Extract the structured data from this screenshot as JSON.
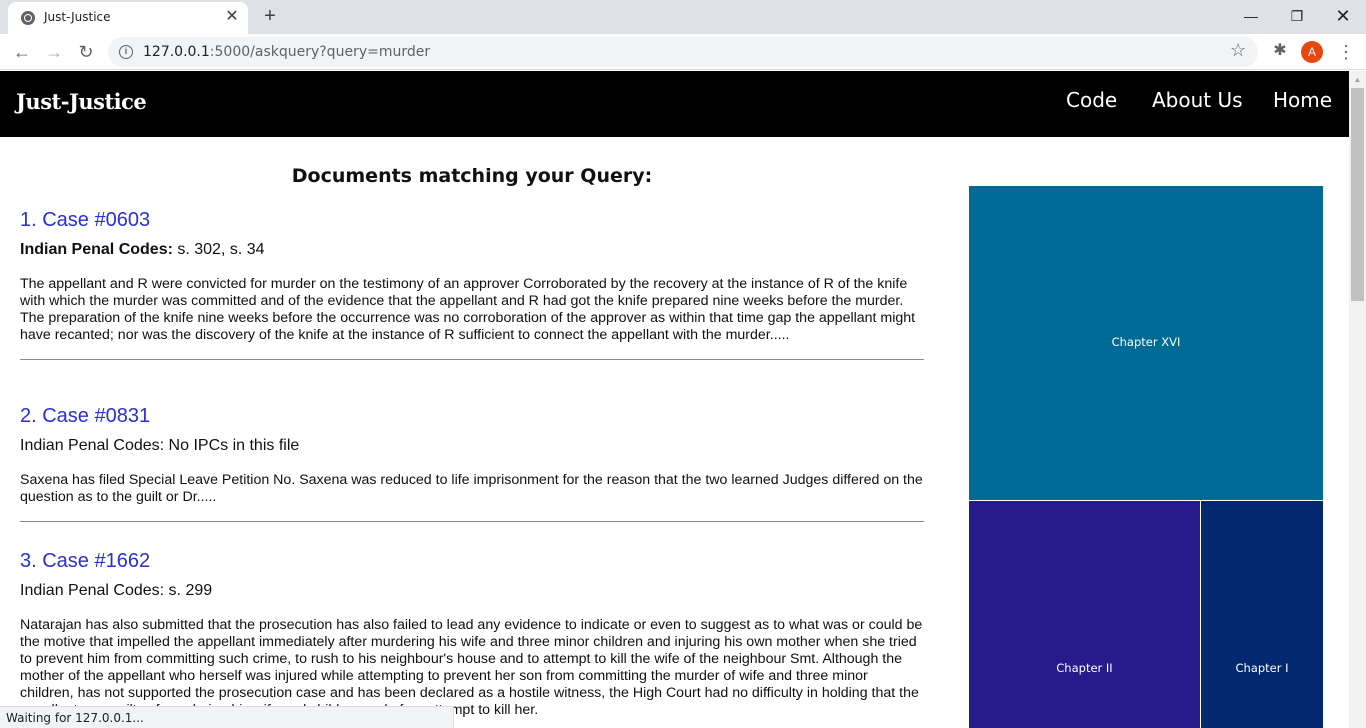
{
  "browser": {
    "tab_title": "Just-Justice",
    "url_host": "127.0.0.1",
    "url_rest": ":5000/askquery?query=murder",
    "avatar_letter": "A",
    "status_text": "Waiting for 127.0.0.1..."
  },
  "site": {
    "brand": "Just-Justice",
    "nav": [
      "Code",
      "About Us",
      "Home"
    ]
  },
  "results": {
    "heading": "Documents matching your Query:",
    "items": [
      {
        "title": "1. Case #0603",
        "ipc_label": "Indian Penal Codes:",
        "ipc_value": " s. 302, s. 34",
        "ipc_bold": true,
        "body": "The appellant and R were convicted for murder on the testimony of an approver Corroborated by the recovery at the instance of R of the knife with which the murder was committed and of the evidence that the appellant and R had got the knife prepared nine weeks before the murder. The preparation of the knife nine weeks before the occurrence was no corroboration of the approver as within that time gap the appellant might have recanted; nor was the discovery of the knife at the instance of R sufficient to connect the appellant with the murder....."
      },
      {
        "title": "2. Case #0831",
        "ipc_label": "Indian Penal Codes:",
        "ipc_value": " No IPCs in this file",
        "ipc_bold": false,
        "body": "Saxena has filed Special Leave Petition No. Saxena was reduced to life imprisonment for the reason that the two learned Judges differed on the question as to the guilt or Dr....."
      },
      {
        "title": "3. Case #1662",
        "ipc_label": "Indian Penal Codes:",
        "ipc_value": " s. 299",
        "ipc_bold": false,
        "body": "Natarajan has also submitted that the prosecution has also failed to lead any evidence to indicate or even to suggest as to what was or could be the motive that impelled the appellant immediately after murdering his wife and three minor children and injuring his own mother when she tried to prevent him from committing such crime, to rush to his neighbour's house and to attempt to kill the wife of the neighbour Smt. Although the mother of the appellant who herself was injured while attempting to prevent her son from committing the murder of wife and three minor children, has not supported the prosecution case and has been declared as a hostile witness, the High Court had no difficulty in holding that the appellant was guilty of murdering his wife and children and of an attempt to kill her."
      }
    ]
  },
  "treemap": {
    "tiles": [
      "Chapter XVI",
      "Chapter II",
      "Chapter I"
    ],
    "colors": [
      "#006b96",
      "#261a8c",
      "#03286f"
    ]
  }
}
